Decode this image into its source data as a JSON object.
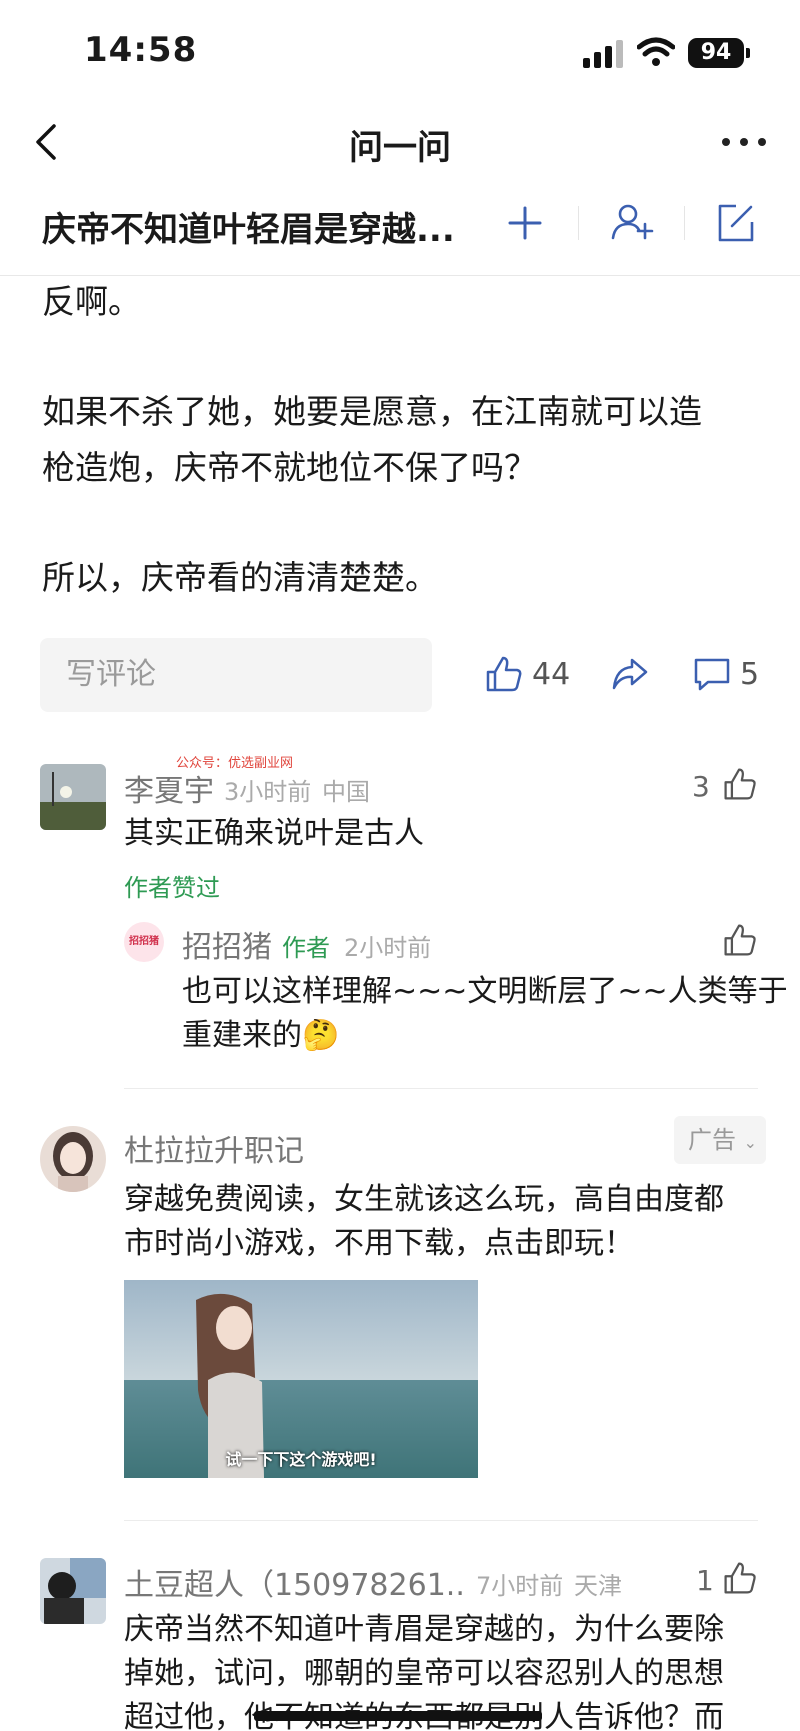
{
  "status_bar": {
    "time": "14:58",
    "battery": "94"
  },
  "nav": {
    "title": "问一问"
  },
  "question": {
    "title": "庆帝不知道叶轻眉是穿越..."
  },
  "answer": {
    "paragraphs": [
      "反啊。",
      "如果不杀了她，她要是愿意，在江南就可以造",
      "枪造炮，庆帝不就地位不保了吗？",
      "所以，庆帝看的清清楚楚。"
    ]
  },
  "actions": {
    "comment_placeholder": "写评论",
    "like_count": "44",
    "comment_count": "5"
  },
  "watermark": "公众号：优选副业网",
  "comments": [
    {
      "name": "李夏宇",
      "time": "3小时前",
      "location": "中国",
      "likes": "3",
      "text": "其实正确来说叶是古人",
      "liked_by_author": "作者赞过",
      "avatar_label": "",
      "reply": {
        "avatar_label": "招招猪",
        "name": "招招猪",
        "tag": "作者",
        "time": "2小时前",
        "text_line1": "也可以这样理解~~~文明断层了~~人类等于",
        "text_line2": "重建来的",
        "emoji": "🤔"
      }
    },
    {
      "name": "杜拉拉升职记",
      "badge": "广告",
      "text_line1": "穿越免费阅读，女生就该这么玩，高自由度都",
      "text_line2": "市时尚小游戏，不用下载，点击即玩！",
      "image_caption": "试一下下这个游戏吧!"
    },
    {
      "name": "土豆超人（150978261...",
      "time": "7小时前",
      "location": "天津",
      "likes": "1",
      "text_line1": "庆帝当然不知道叶青眉是穿越的，为什么要除",
      "text_line2": "掉她，试问，哪朝的皇帝可以容忍别人的思想",
      "text_line3": "超过他，他不知道的东西都是别人告诉他？而"
    }
  ]
}
